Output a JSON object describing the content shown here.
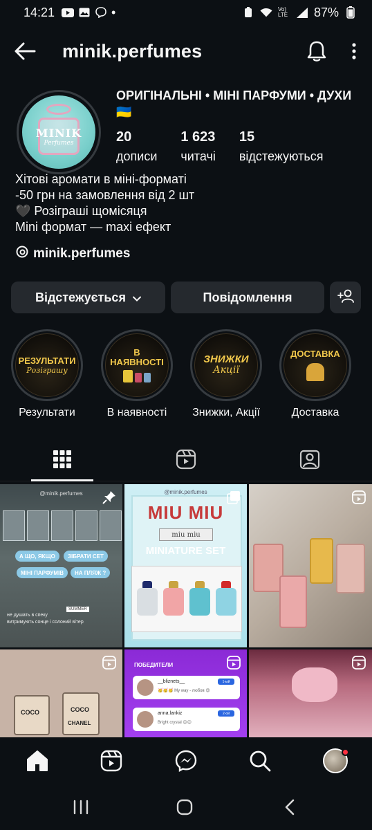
{
  "status_bar": {
    "time": "14:21",
    "dot": "•",
    "network_label": "Vo) LTE",
    "battery": "87%"
  },
  "top_bar": {
    "username": "minik.perfumes"
  },
  "profile": {
    "name": "ОРИГІНАЛЬНІ • МІНІ ПАРФУМИ • ДУХИ 🇺🇦",
    "avatar_brand": "MINIK",
    "avatar_sub": "Perfumes",
    "stats": [
      {
        "count": "20",
        "label": "дописи"
      },
      {
        "count": "1 623",
        "label": "читачі"
      },
      {
        "count": "15",
        "label": "відстежуються"
      }
    ],
    "bio": [
      "Хітові аромати в міні-форматі",
      "-50 грн на замовлення від 2 шт",
      "🖤 Розіграші щомісяця",
      "Mini формат — maxi ефект"
    ],
    "threads_handle": "minik.perfumes"
  },
  "actions": {
    "follow_label": "Відстежується",
    "message_label": "Повідомлення"
  },
  "highlights": [
    {
      "label": "Результати",
      "cover_title": "РЕЗУЛЬТАТИ",
      "cover_sub": "Розіграшу"
    },
    {
      "label": "В наявності",
      "cover_title": "В НАЯВНОСТІ",
      "cover_sub": ""
    },
    {
      "label": "Знижки, Акції",
      "cover_title": "ЗНИЖКИ",
      "cover_sub": "Акції"
    },
    {
      "label": "Доставка",
      "cover_title": "ДОСТАВКА",
      "cover_sub": ""
    }
  ],
  "posts": {
    "post1": {
      "handle": "@minik.perfumes",
      "pills": [
        "А ЩО, ЯКЩО",
        "ЗІБРАТИ СЕТ",
        "МІНІ ПАРФУМІВ",
        "НА ПЛЯЖ ?"
      ],
      "note1": "не душать в спеку",
      "note2": "витримують сонце і солоний вітер",
      "tag": "SUMMER"
    },
    "post2": {
      "handle": "@minik.perfumes",
      "brand": "MIU MIU",
      "plaque": "miu miu",
      "subtitle": "MINIATURE SET"
    },
    "post4": {
      "label1": "COCO",
      "label2": "COCO",
      "label3": "CHANEL"
    },
    "post5": {
      "header": "ПОБЕДИТЕЛИ",
      "entries": [
        {
          "name": "__bliznets__",
          "msg": "🥳🥳🥳 My way - любов 😍",
          "tag": "1-ый"
        },
        {
          "name": "anna.lankiz",
          "msg": "Bright crystal 😊😊",
          "tag": "2-ой"
        }
      ]
    }
  },
  "colors": {
    "background": "#0c1014",
    "button": "#25292e",
    "highlight_gold": "#f2c94c",
    "notification": "#ff3040"
  },
  "icons": {
    "back": "arrow-left-icon",
    "notifications": "bell-icon",
    "more": "more-vertical-icon",
    "threads": "threads-icon",
    "add_user": "add-user-icon",
    "grid": "grid-icon",
    "reels": "reels-icon",
    "tagged": "tagged-icon",
    "home": "home-icon",
    "messenger": "messenger-icon",
    "search": "search-icon"
  }
}
